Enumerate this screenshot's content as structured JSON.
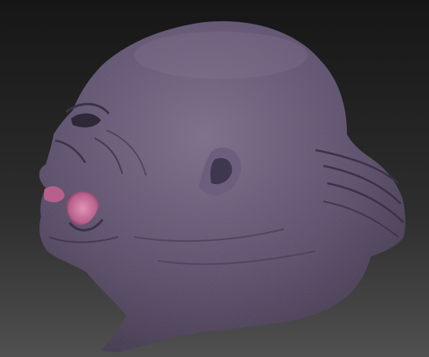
{
  "scene": {
    "subject": "sculpted-head-side-profile",
    "background": {
      "top": "#1a1a1a",
      "bottom": "#4a4a4a"
    },
    "colors": {
      "skin_base": "#564b6a",
      "skin_highlight": "#7b6d8a",
      "skin_shadow": "#2e2838",
      "mouth_interior": "#c7709a",
      "ear_inner": "#3f3650",
      "wrinkle": "#3a3246"
    }
  }
}
